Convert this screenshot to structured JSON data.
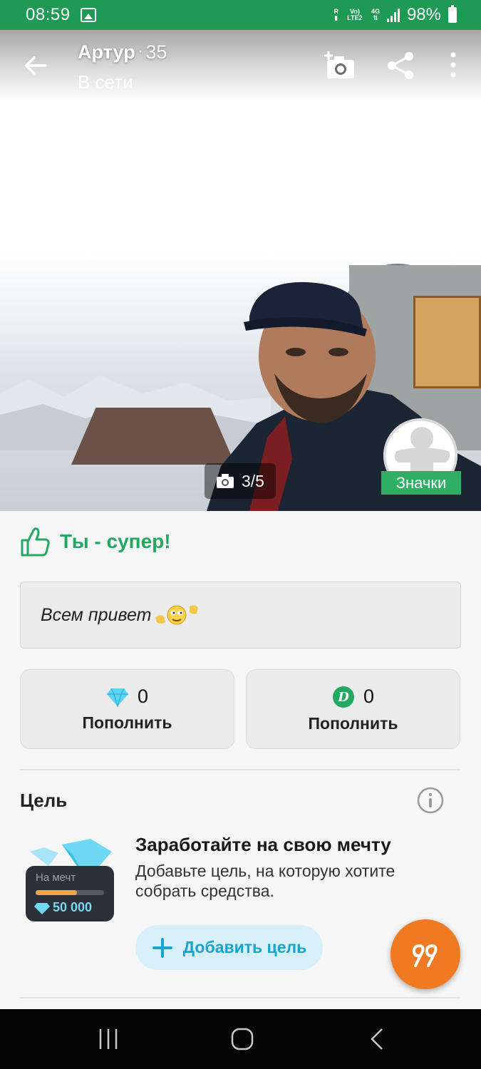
{
  "status_bar": {
    "time": "08:59",
    "net_r": "R",
    "volte": "Vo) LTE2",
    "net_type": "4G",
    "battery": "98%"
  },
  "header": {
    "name": "Артур",
    "separator": "·",
    "age": "35",
    "presence": "В сети"
  },
  "photo": {
    "counter": "3/5",
    "badges_label": "Значки"
  },
  "compliment": {
    "text": "Ты - супер!"
  },
  "status_message": {
    "text": "Всем привет"
  },
  "wallets": [
    {
      "icon": "diamond-icon",
      "amount": "0",
      "action": "Пополнить"
    },
    {
      "icon": "coin-icon",
      "amount": "0",
      "action": "Пополнить"
    }
  ],
  "goal": {
    "section_title": "Цель",
    "heading": "Заработайте на свою мечту",
    "description": "Добавьте цель, на которую хотите собрать средства.",
    "image_caption": "На мечт",
    "image_amount": "50 000",
    "add_button": "Добавить цель"
  },
  "colors": {
    "accent_green": "#1e9a55",
    "goal_blue": "#1aa3cf",
    "fab_orange": "#f07a22"
  }
}
